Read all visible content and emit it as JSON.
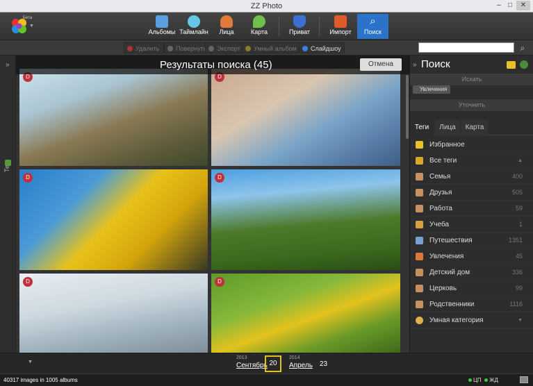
{
  "app": {
    "title": "ZZ Photo",
    "beta": "Бета"
  },
  "window_controls": {
    "minimize": "–",
    "maximize": "□",
    "close": "✕"
  },
  "nav": [
    {
      "label": "Альбомы",
      "icon": "albums-icon",
      "color": "#5aa0e0"
    },
    {
      "label": "Таймлайн",
      "icon": "clock-icon",
      "color": "#66c6e8"
    },
    {
      "label": "Лица",
      "icon": "face-icon",
      "color": "#e07a3a"
    },
    {
      "label": "Карта",
      "icon": "map-icon",
      "color": "#6fbf4a"
    },
    {
      "label": "Приват",
      "icon": "shield-icon",
      "color": "#3b6fd4"
    },
    {
      "label": "Импорт",
      "icon": "import-icon",
      "color": "#e05a2a"
    },
    {
      "label": "Поиск",
      "icon": "search-icon",
      "color": "#ffffff"
    }
  ],
  "actions": {
    "delete": "Удалить",
    "rotate": "Повернуть",
    "export": "Экспорт",
    "smart_album": "Умный альбом",
    "slideshow": "Слайдшоу"
  },
  "results": {
    "title": "Результаты поиска (45)",
    "cancel": "Отмена"
  },
  "left_panel": {
    "tags_label": "Теги",
    "expand": "»"
  },
  "photo_badge": "D",
  "right_panel": {
    "title": "Поиск",
    "collapse": "»",
    "find_label": "Искать",
    "chip": "Увлечения",
    "refine_label": "Уточнить",
    "tabs": [
      "Теги",
      "Лица",
      "Карта"
    ],
    "tags": [
      {
        "label": "Избранное",
        "count": "",
        "icon": "star-icon",
        "color": "#e8c02a"
      },
      {
        "label": "Все теги",
        "count": "",
        "icon": "folder-icon",
        "color": "#d8a82a"
      },
      {
        "label": "Семья",
        "count": "400",
        "icon": "tag-icon",
        "color": "#c89060"
      },
      {
        "label": "Друзья",
        "count": "505",
        "icon": "tag-icon",
        "color": "#c89060"
      },
      {
        "label": "Работа",
        "count": "59",
        "icon": "tag-icon",
        "color": "#c89060"
      },
      {
        "label": "Учеба",
        "count": "1",
        "icon": "tag-icon",
        "color": "#d8a040"
      },
      {
        "label": "Путешествия",
        "count": "1351",
        "icon": "tag-icon",
        "color": "#7aa0d0"
      },
      {
        "label": "Увлечения",
        "count": "45",
        "icon": "tag-icon",
        "color": "#d87a3a"
      },
      {
        "label": "Детский дом",
        "count": "336",
        "icon": "tag-icon",
        "color": "#c89060"
      },
      {
        "label": "Церковь",
        "count": "99",
        "icon": "tag-icon",
        "color": "#c89060"
      },
      {
        "label": "Родственники",
        "count": "1116",
        "icon": "tag-icon",
        "color": "#c89060"
      },
      {
        "label": "Умная категория",
        "count": "",
        "icon": "smart-icon",
        "color": "#e0b050"
      }
    ]
  },
  "timeline": {
    "left": {
      "year": "2013",
      "month": "Сентябрь",
      "day": "20"
    },
    "right": {
      "year": "2014",
      "month": "Апрель",
      "day": "23"
    }
  },
  "status": {
    "left": "40317 images in 1005 albums",
    "cpu": "ЦП",
    "hdd": "ЖД"
  }
}
